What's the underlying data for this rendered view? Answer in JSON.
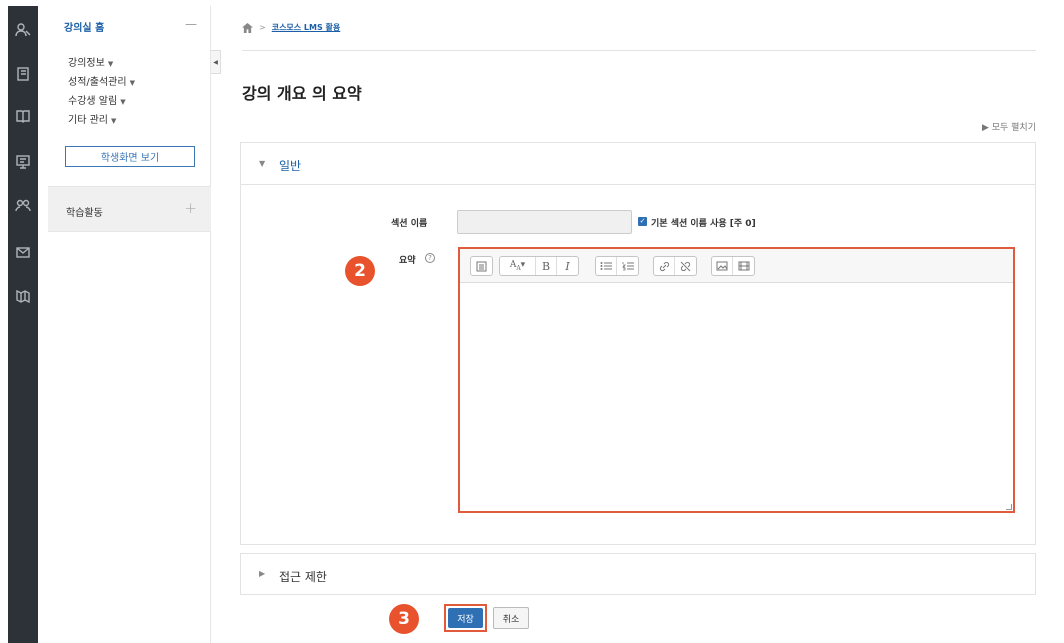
{
  "nav": {
    "home_label": "강의실 홈",
    "home_collapse": "—",
    "items": [
      {
        "label": "강의정보"
      },
      {
        "label": "성적/출석관리"
      },
      {
        "label": "수강생 알림"
      },
      {
        "label": "기타 관리"
      }
    ],
    "student_view_button": "학생화면 보기",
    "activity_label": "학습활동",
    "activity_add": "+"
  },
  "breadcrumb": {
    "separator": ">",
    "current": "코스모스 LMS 활용"
  },
  "page": {
    "title": "강의 개요 의 요약",
    "expand_all": "▶ 모두 펼치기"
  },
  "general": {
    "legend": "일반",
    "section_name_label": "섹션 이름",
    "section_name_value": "",
    "default_name_checkbox_label": "기본 섹션 이름 사용 [주 0]",
    "default_name_checked": true,
    "summary_label": "요약",
    "help_symbol": "?",
    "summary_value": ""
  },
  "access": {
    "legend": "접근 제한"
  },
  "actions": {
    "save": "저장",
    "cancel": "취소"
  },
  "annotations": {
    "step2": "2",
    "step3": "3"
  },
  "icons": {
    "rail": [
      "user-icon",
      "notebook-icon",
      "book-icon",
      "presentation-icon",
      "users-icon",
      "mail-icon",
      "map-icon"
    ],
    "toolbar": [
      "toggle-toolbar-icon",
      "font-style-icon",
      "bold-icon",
      "italic-icon",
      "unordered-list-icon",
      "ordered-list-icon",
      "link-icon",
      "unlink-icon",
      "image-icon",
      "media-icon"
    ]
  },
  "colors": {
    "rail_bg": "#2d3238",
    "link_blue": "#1b5fa8",
    "primary": "#2f6fb4",
    "highlight": "#e15a3c",
    "badge": "#e8532e"
  }
}
